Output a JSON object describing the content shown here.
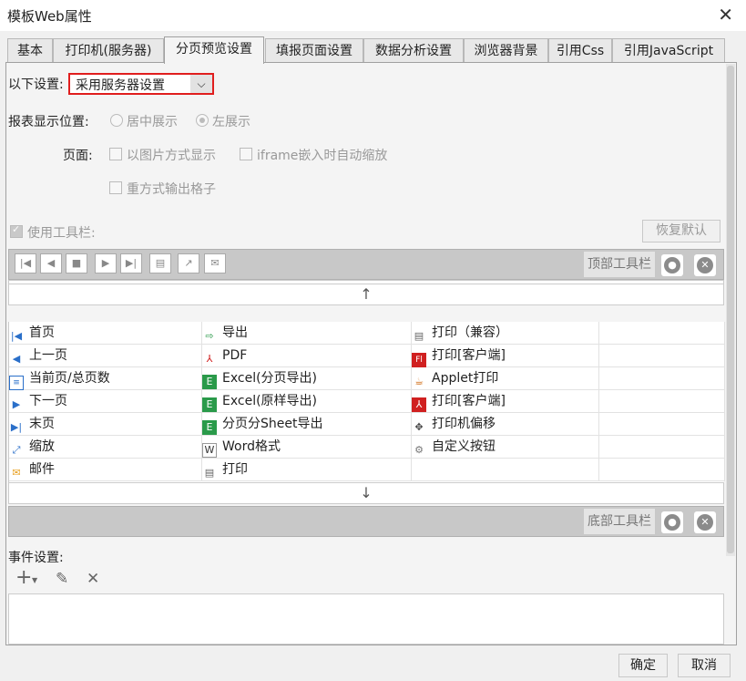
{
  "window": {
    "title": "模板Web属性",
    "close_glyph": "✕"
  },
  "tabs": [
    {
      "label": "基本"
    },
    {
      "label": "打印机(服务器)"
    },
    {
      "label": "分页预览设置"
    },
    {
      "label": "填报页面设置"
    },
    {
      "label": "数据分析设置"
    },
    {
      "label": "浏览器背景"
    },
    {
      "label": "引用Css"
    },
    {
      "label": "引用JavaScript"
    }
  ],
  "active_tab": "分页预览设置",
  "settings": {
    "label": "以下设置:",
    "selected": "采用服务器设置",
    "options_arrow": "⌵"
  },
  "report_position": {
    "label": "报表显示位置:",
    "options": [
      {
        "label": "居中展示",
        "checked": false
      },
      {
        "label": "左展示",
        "checked": true
      }
    ]
  },
  "page": {
    "label": "页面:",
    "options": [
      {
        "label": "以图片方式显示",
        "checked": false
      },
      {
        "label": "iframe嵌入时自动缩放",
        "checked": false
      },
      {
        "label": "重方式输出格子",
        "checked": false
      }
    ]
  },
  "toolbar": {
    "use_label": "使用工具栏:",
    "use_checked": true,
    "restore_label": "恢复默认",
    "top_label": "顶部工具栏",
    "bottom_label": "底部工具栏",
    "up_arrow": "↑",
    "down_arrow": "↓",
    "top_icons": [
      "first-page-icon",
      "prev-page-icon",
      "stop-icon",
      "next-page-icon",
      "last-page-icon",
      "print-icon",
      "export-icon",
      "mail-icon"
    ]
  },
  "items": {
    "col1": [
      {
        "label": "首页",
        "icon": "first-page-icon"
      },
      {
        "label": "上一页",
        "icon": "prev-page-icon"
      },
      {
        "label": "当前页/总页数",
        "icon": "page-count-icon"
      },
      {
        "label": "下一页",
        "icon": "next-page-icon"
      },
      {
        "label": "末页",
        "icon": "last-page-icon"
      },
      {
        "label": "缩放",
        "icon": "zoom-icon"
      },
      {
        "label": "邮件",
        "icon": "mail-icon"
      }
    ],
    "col2": [
      {
        "label": "导出",
        "icon": "export-icon"
      },
      {
        "label": "PDF",
        "icon": "pdf-icon"
      },
      {
        "label": "Excel(分页导出)",
        "icon": "excel-icon"
      },
      {
        "label": "Excel(原样导出)",
        "icon": "excel-icon"
      },
      {
        "label": "分页分Sheet导出",
        "icon": "excel-icon"
      },
      {
        "label": "Word格式",
        "icon": "word-icon"
      },
      {
        "label": "打印",
        "icon": "print-icon"
      }
    ],
    "col3": [
      {
        "label": "打印（兼容）",
        "icon": "print-icon"
      },
      {
        "label": "打印[客户端]",
        "icon": "flash-print-icon"
      },
      {
        "label": "Applet打印",
        "icon": "applet-print-icon"
      },
      {
        "label": "打印[客户端]",
        "icon": "pdf-print-icon"
      },
      {
        "label": "打印机偏移",
        "icon": "move-icon"
      },
      {
        "label": "自定义按钮",
        "icon": "gear-icon"
      }
    ]
  },
  "events": {
    "label": "事件设置:",
    "add_glyph": "+",
    "edit_glyph": "✎",
    "delete_glyph": "✕"
  },
  "footer": {
    "ok_label": "确定",
    "cancel_label": "取消"
  },
  "colors": {
    "highlight_border": "#e01e1e",
    "toolbar_gray": "#c8c8c8"
  }
}
